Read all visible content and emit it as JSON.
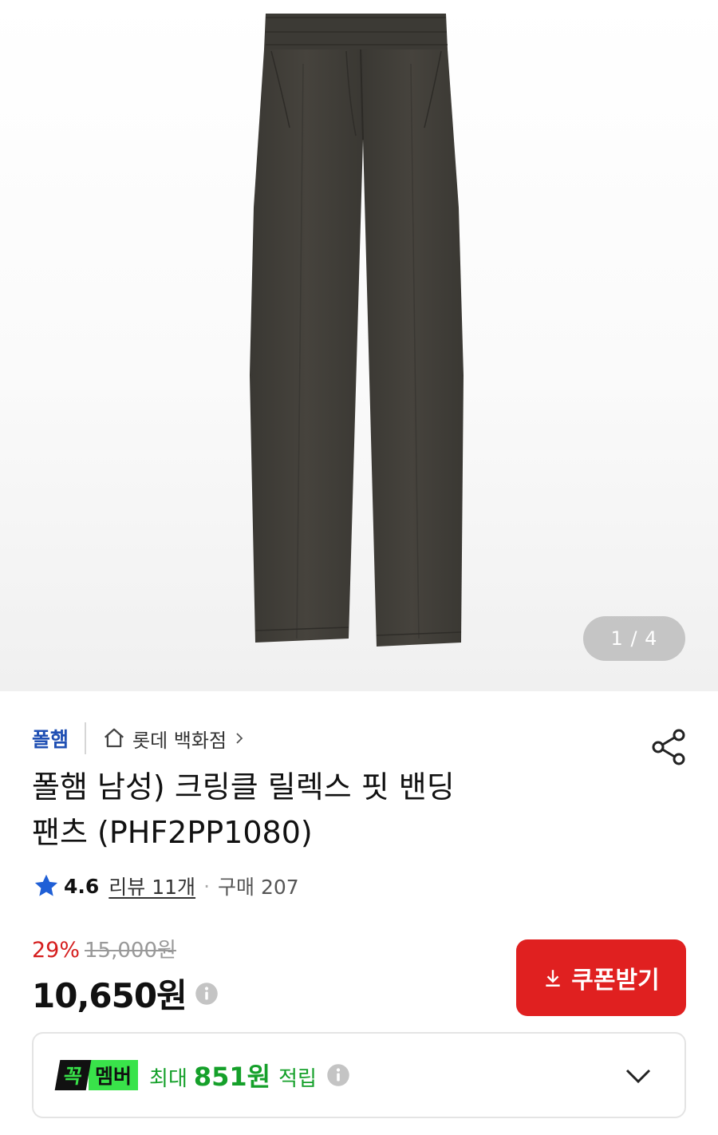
{
  "gallery": {
    "counter": "1 / 4",
    "image_alt": "폴햄 남성 크링클 릴렉스 핏 밴딩 팬츠 (다크 그레이)",
    "colors": {
      "pants": "#3f3d38",
      "background": "#f7f7f7"
    }
  },
  "brand": {
    "name": "폴햄",
    "store": "롯데 백화점",
    "color": "#1f4fb3"
  },
  "product": {
    "title_line1": "폴햄 남성) 크링클 릴렉스 핏 밴딩",
    "title_line2": "팬츠 (PHF2PP1080)"
  },
  "rating": {
    "score": "4.6",
    "reviews": "리뷰 11개",
    "separator": "·",
    "purchases": "구매 207",
    "star_color": "#1f5fd6"
  },
  "price": {
    "discount": "29%",
    "original": "15,000원",
    "current": "10,650원",
    "discount_color": "#d51d1d"
  },
  "coupon": {
    "label": "쿠폰받기",
    "color": "#e02020"
  },
  "membership": {
    "badge_a": "꼭",
    "badge_b": "멤버",
    "prefix": "최대",
    "amount": "851원",
    "suffix": "적립",
    "accent": "#39e34a"
  }
}
